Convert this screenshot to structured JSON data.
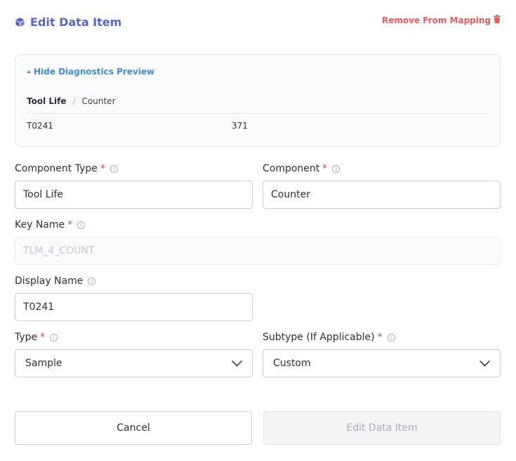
{
  "header": {
    "title": "Edit Data Item",
    "title_icon": "cube-icon",
    "remove_label": "Remove From Mapping",
    "remove_icon": "trash-icon",
    "accent_color": "#5468c9",
    "danger_color": "#e35d5d"
  },
  "diagnostics": {
    "toggle_label": "Hide Diagnostics Preview",
    "breadcrumb": [
      "Tool Life",
      "Counter"
    ],
    "separator": "/",
    "row": [
      "T0241",
      "371"
    ]
  },
  "form": {
    "component_type": {
      "label": "Component Type",
      "required": "*",
      "value": "Tool Life"
    },
    "component": {
      "label": "Component",
      "required": "*",
      "value": "Counter"
    },
    "key_name": {
      "label": "Key Name",
      "required": "*",
      "value": "TLM_4_COUNT"
    },
    "display_name": {
      "label": "Display Name",
      "value": "T0241"
    },
    "type": {
      "label": "Type",
      "required": "*",
      "selected": "Sample"
    },
    "subtype": {
      "label": "Subtype (If Applicable)",
      "required": "*",
      "selected": "Custom"
    },
    "info_glyph": "i"
  },
  "buttons": {
    "cancel": "Cancel",
    "submit": "Edit Data Item"
  }
}
